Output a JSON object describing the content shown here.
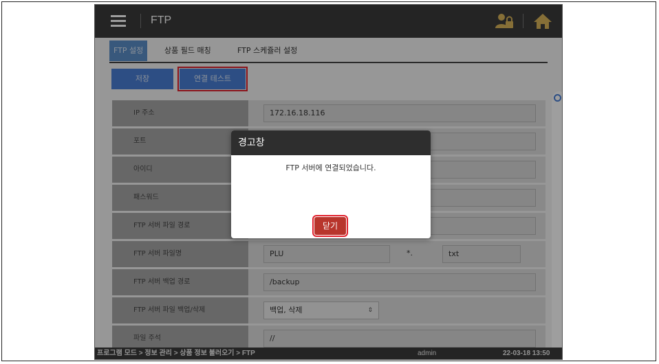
{
  "app": {
    "title": "FTP"
  },
  "tabs": [
    {
      "label": "FTP 설정",
      "active": true
    },
    {
      "label": "상품 필드 매칭",
      "active": false
    },
    {
      "label": "FTP 스케쥴러 설정",
      "active": false
    }
  ],
  "toolbar": {
    "save_label": "저장",
    "test_label": "연결 테스트"
  },
  "form": {
    "ip": {
      "label": "IP 주소",
      "value": "172.16.18.116"
    },
    "port": {
      "label": "포트",
      "value": ""
    },
    "id": {
      "label": "아이디",
      "value": ""
    },
    "password": {
      "label": "패스워드",
      "value": ""
    },
    "path": {
      "label": "FTP 서버 파일 경로",
      "value": ""
    },
    "filename": {
      "label": "FTP 서버 파일명",
      "value": "PLU",
      "separator": "*.",
      "ext": "txt"
    },
    "backup_path": {
      "label": "FTP 서버 백업 경로",
      "value": "/backup"
    },
    "backup_delete": {
      "label": "FTP 서버 파일 백업/삭제",
      "value": "백업, 삭제"
    },
    "comment": {
      "label": "파일 주석",
      "value": "//"
    }
  },
  "statusbar": {
    "path": "프로그램 모드 > 정보 관리 > 상품 정보 불러오기 > FTP",
    "user": "admin",
    "time": "22-03-18 13:50"
  },
  "dialog": {
    "title": "경고창",
    "message": "FTP 서버에 연결되었습니다.",
    "close_label": "닫기"
  },
  "colors": {
    "accent": "#4a7fd6",
    "topbar": "#3a3a3a",
    "close": "#b8352c",
    "highlight": "#e01e2a"
  }
}
